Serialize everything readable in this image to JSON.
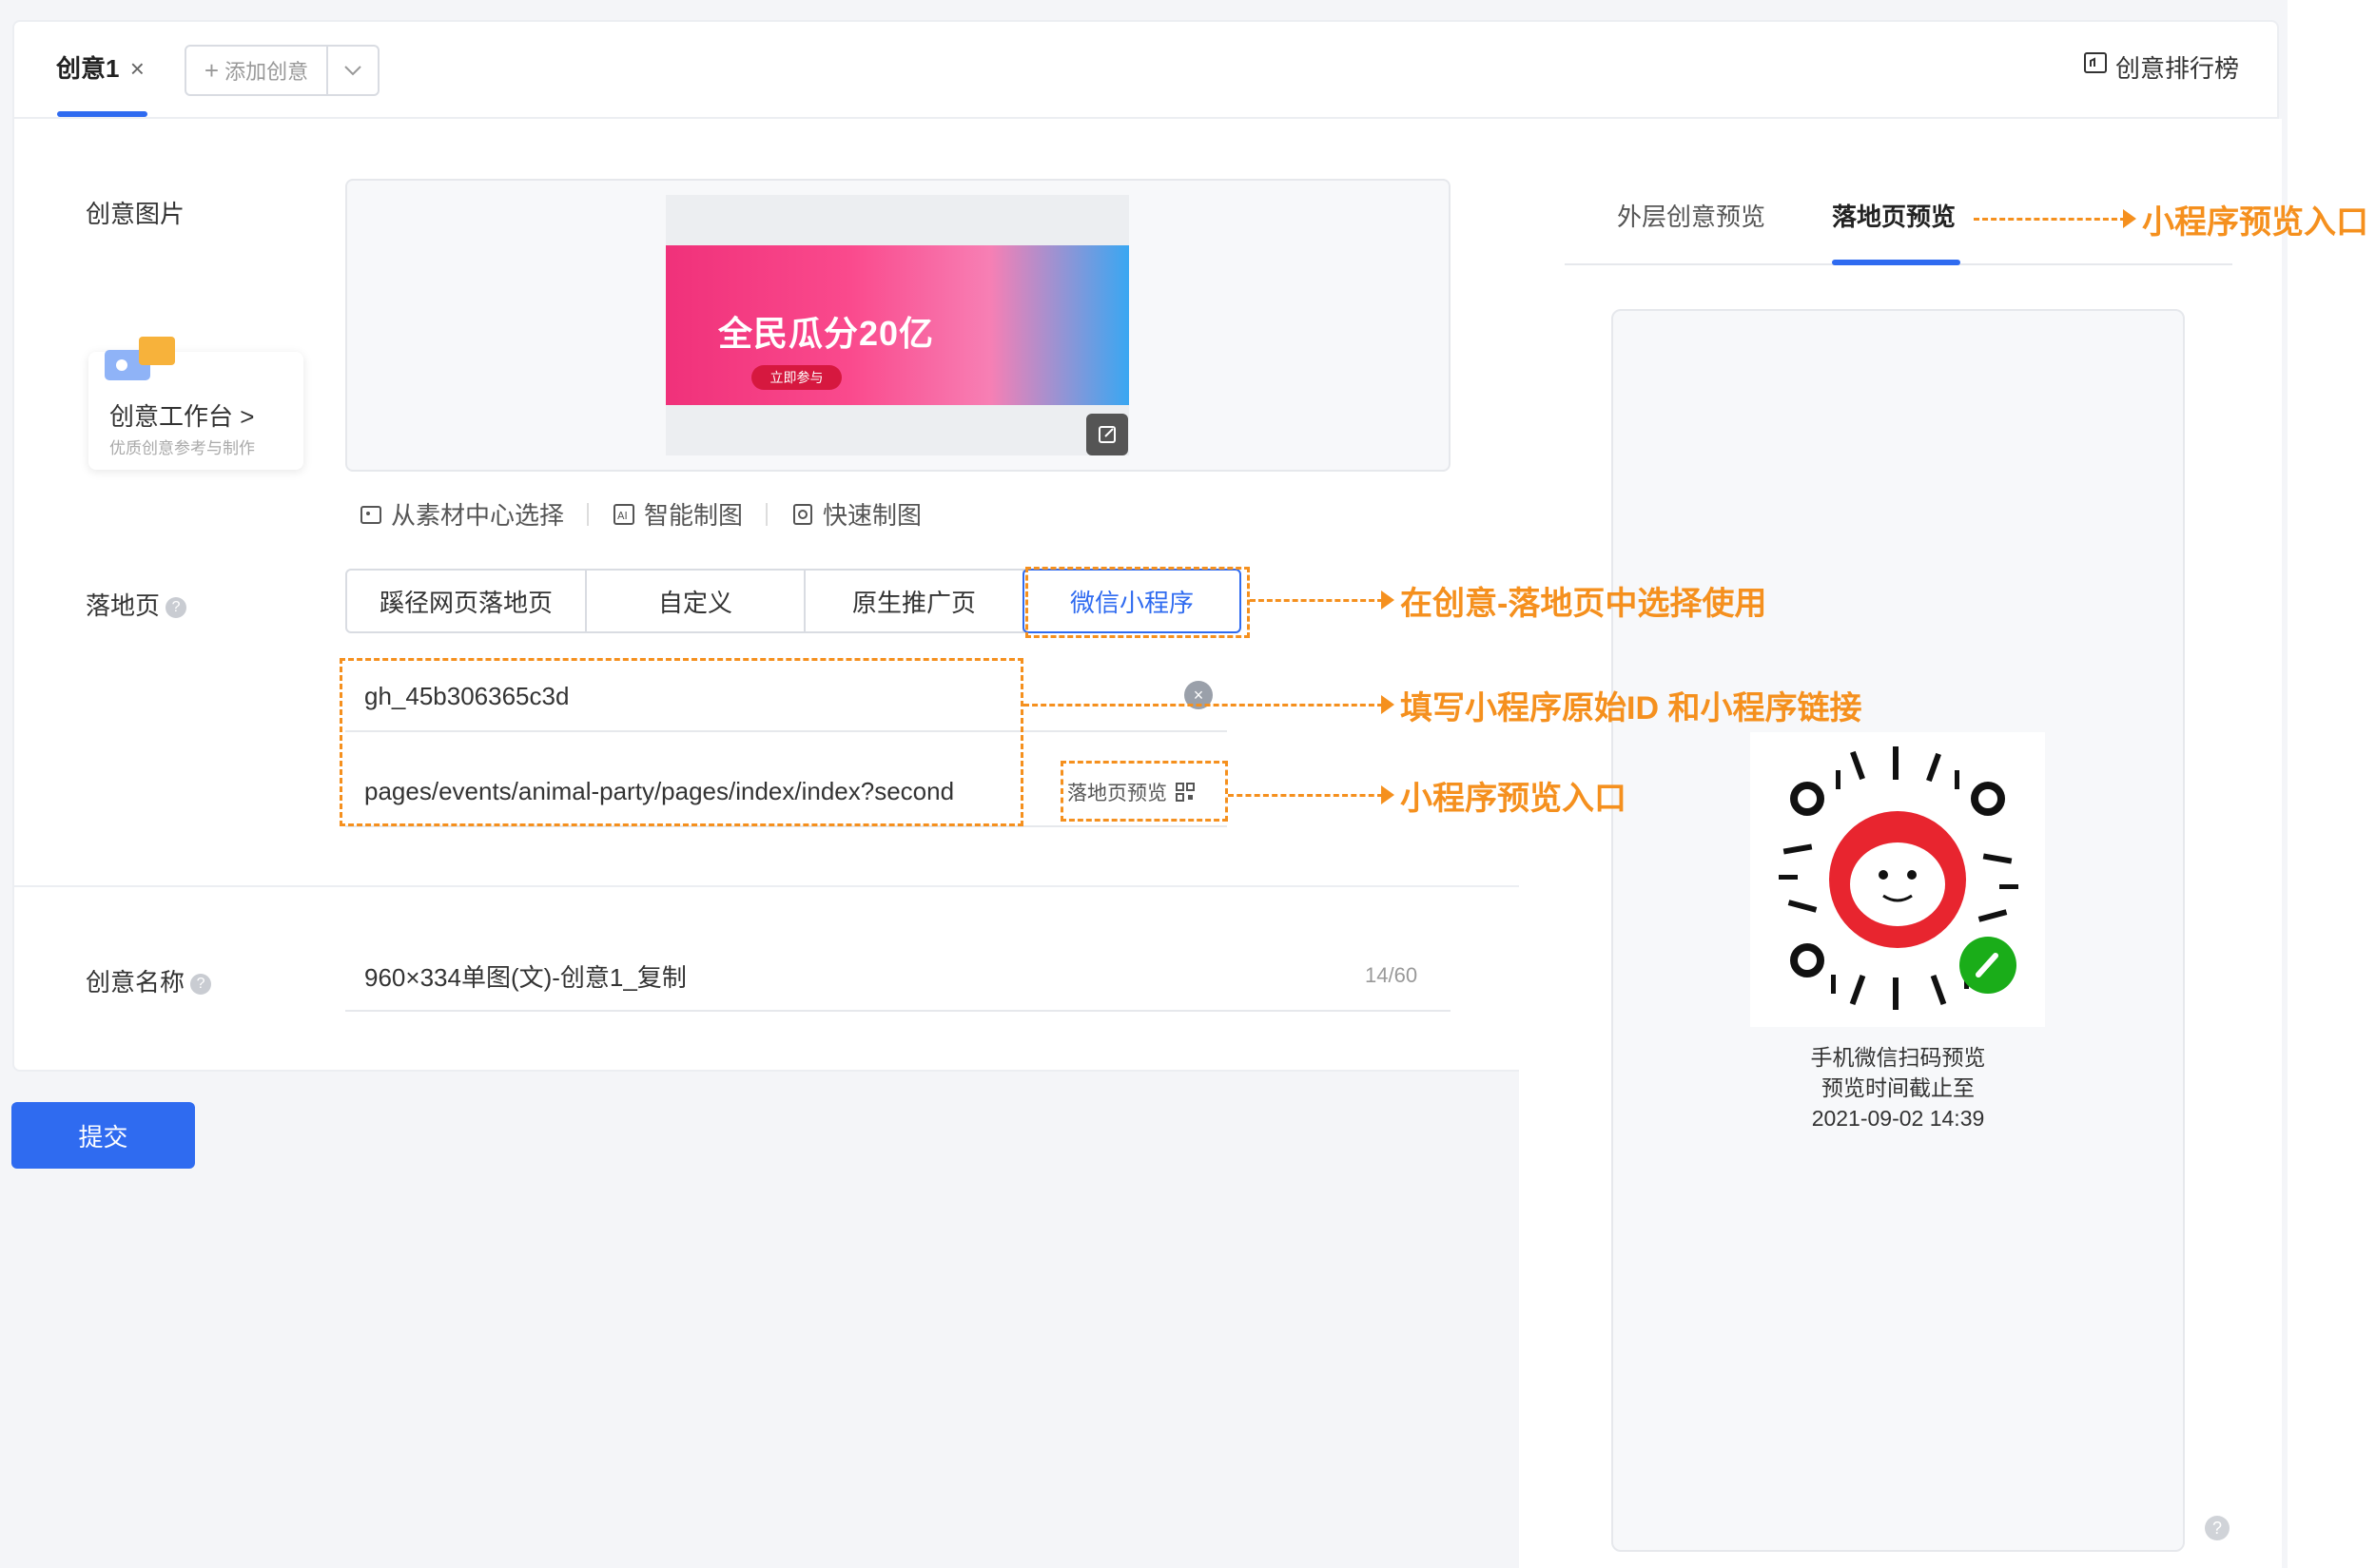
{
  "header": {
    "tab_label": "创意1",
    "close_glyph": "×",
    "add_label": "添加创意",
    "add_glyph": "+",
    "rank_label": "创意排行榜"
  },
  "form": {
    "image_label": "创意图片",
    "banner": {
      "headline": "全民瓜分20亿",
      "button": "立即参与"
    },
    "workbench": {
      "title": "创意工作台 >",
      "subtitle": "优质创意参考与制作"
    },
    "tools": [
      "从素材中心选择",
      "智能制图",
      "快速制图"
    ],
    "landing_label": "落地页",
    "landing_options": [
      "蹊径网页落地页",
      "自定义",
      "原生推广页",
      "微信小程序"
    ],
    "landing_selected": "微信小程序",
    "miniprogram_id": "gh_45b306365c3d",
    "miniprogram_path": "pages/events/animal-party/pages/index/index?second",
    "preview_link": "落地页预览",
    "name_label": "创意名称",
    "name_value": "960×334单图(文)-创意1_复制",
    "name_counter": "14/60",
    "help_glyph": "?"
  },
  "submit_label": "提交",
  "preview": {
    "tab_outer": "外层创意预览",
    "tab_landing": "落地页预览",
    "qr_caption_1": "手机微信扫码预览",
    "qr_caption_2": "预览时间截止至",
    "qr_caption_3": "2021-09-02 14:39"
  },
  "annotations": {
    "a1": "小程序预览入口",
    "a2": "在创意-落地页中选择使用",
    "a3": "填写小程序原始ID 和小程序链接",
    "a4": "小程序预览入口"
  },
  "colors": {
    "accent": "#2f6bf0",
    "annotation": "#f5901e"
  }
}
